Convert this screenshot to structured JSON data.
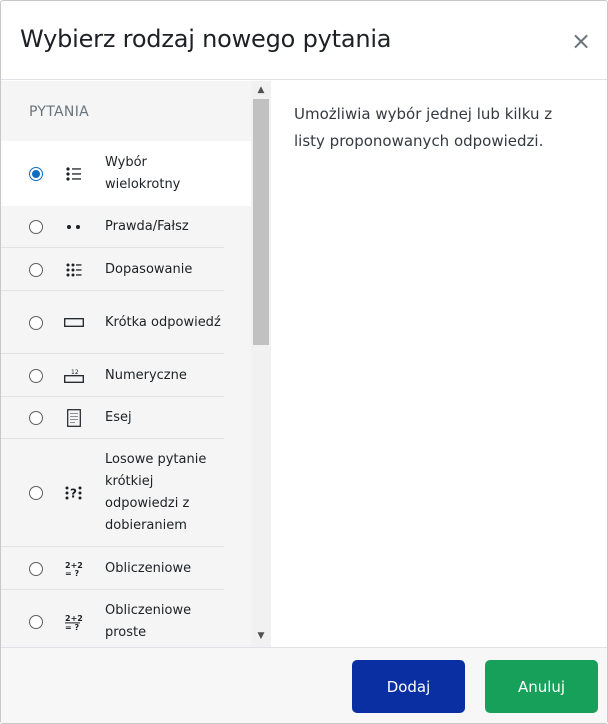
{
  "dialog": {
    "title": "Wybierz rodzaj nowego pytania",
    "close_glyph": "×"
  },
  "list": {
    "heading": "PYTANIA",
    "items": [
      {
        "label": "Wybór wielokrotny",
        "icon": "multichoice-icon",
        "checked": true
      },
      {
        "label": "Prawda/Fałsz",
        "icon": "truefalse-icon",
        "checked": false
      },
      {
        "label": "Dopasowanie",
        "icon": "match-icon",
        "checked": false
      },
      {
        "label": "Krótka odpowiedź",
        "icon": "shortanswer-icon",
        "checked": false
      },
      {
        "label": "Numeryczne",
        "icon": "numerical-icon",
        "number_text": "12",
        "checked": false
      },
      {
        "label": "Esej",
        "icon": "essay-icon",
        "checked": false
      },
      {
        "label": "Losowe pytanie krótkiej odpowiedzi z dobieraniem",
        "icon": "randomsamatch-icon",
        "checked": false
      },
      {
        "label": "Obliczeniowe",
        "icon": "calculated-icon",
        "icon_text": [
          "2+2",
          "= ?"
        ],
        "checked": false
      },
      {
        "label": "Obliczeniowe proste",
        "icon": "calculatedsimple-icon",
        "icon_text": [
          "2+2",
          "= ?"
        ],
        "checked": false
      }
    ]
  },
  "description": "Umożliwia wybór jednej lub kilku z listy proponowanych odpowiedzi.",
  "footer": {
    "add_label": "Dodaj",
    "cancel_label": "Anuluj"
  },
  "colors": {
    "primary": "#0a2fa2",
    "success": "#17a05a",
    "radio_selected": "#0f6cbf"
  }
}
